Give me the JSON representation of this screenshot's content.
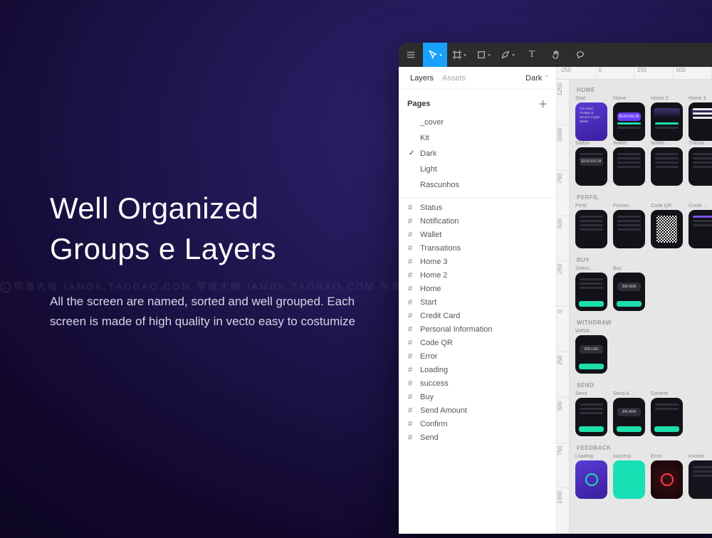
{
  "hero": {
    "title_line1": "Well Organized",
    "title_line2": "Groups e Layers",
    "body": "All the screen are named, sorted and well grouped. Each screen is made of high quality in vecto easy to costumize"
  },
  "watermark": "早道大咖  IAMDK.TAOBAO.COM      早道大咖  IAMDK.TAOBAO.COM      早道大咖  IAMDK.TAOBAO.COM",
  "figma": {
    "toolbar": {
      "items": [
        "menu",
        "move",
        "frame",
        "shape",
        "pen",
        "text",
        "hand",
        "comment"
      ]
    },
    "tabs": {
      "layers": "Layers",
      "assets": "Assets"
    },
    "file_label": "Dark",
    "pages_header": "Pages",
    "pages": [
      {
        "name": "_cover",
        "selected": false
      },
      {
        "name": "Kit",
        "selected": false
      },
      {
        "name": "Dark",
        "selected": true
      },
      {
        "name": "Light",
        "selected": false
      },
      {
        "name": "Rascunhos",
        "selected": false
      }
    ],
    "layers": [
      "Status",
      "Notification",
      "Wallet",
      "Transations",
      "Home 3",
      "Home 2",
      "Home",
      "Start",
      "Credit Card",
      "Personal Information",
      "Code QR",
      "Error",
      "Loading",
      "success",
      "Buy",
      "Send Amount",
      "Confirm",
      "Send"
    ],
    "ruler_h": [
      "-250",
      "0",
      "250",
      "500"
    ],
    "ruler_v": [
      "-1250",
      "-1000",
      "-750",
      "-500",
      "-250",
      "0",
      "250",
      "500",
      "750",
      "1000"
    ],
    "canvas": {
      "sections": [
        {
          "label": "HOME",
          "rows": [
            [
              {
                "name": "Start",
                "style": "purple",
                "text": "The Most Trusted & Secure Crypto Wallet"
              },
              {
                "name": "Home",
                "style": "dark",
                "pill": "$120,910.28",
                "pillStyle": "purple",
                "bars": true
              },
              {
                "name": "Home 2",
                "style": "dark",
                "chart": true,
                "bars": true
              },
              {
                "name": "Home 3",
                "style": "dark",
                "chart": true,
                "listWhite": true
              }
            ],
            [
              {
                "name": "Status",
                "style": "dark",
                "pill": "$120,910.28",
                "pillStyle": "gray",
                "lines": 2
              },
              {
                "name": "Wallet",
                "style": "dark",
                "lines": 4
              },
              {
                "name": "Notific…",
                "style": "dark",
                "lines": 4
              },
              {
                "name": "Transa…",
                "style": "dark",
                "lines": 4
              }
            ]
          ]
        },
        {
          "label": "PERFIL",
          "rows": [
            [
              {
                "name": "Perfil",
                "style": "dark",
                "lines": 4
              },
              {
                "name": "Person…",
                "style": "dark",
                "lines": 4
              },
              {
                "name": "Code QR",
                "style": "dark",
                "qr": true
              },
              {
                "name": "Credit …",
                "style": "dark",
                "lines": 3,
                "lineStyle": "purple"
              }
            ]
          ]
        },
        {
          "label": "BUY",
          "rows": [
            [
              {
                "name": "Select…",
                "style": "dark",
                "lines": 3,
                "bar": true
              },
              {
                "name": "Buy",
                "style": "dark",
                "pill": "200 ADA",
                "pillStyle": "gray",
                "bar": true
              }
            ]
          ]
        },
        {
          "label": "WITHDRAW",
          "rows": [
            [
              {
                "name": "Withdr…",
                "style": "dark",
                "pill": "200 USD",
                "pillStyle": "gray",
                "bar": true
              }
            ]
          ]
        },
        {
          "label": "SEND",
          "rows": [
            [
              {
                "name": "Send",
                "style": "dark",
                "lines": 3,
                "bar": true
              },
              {
                "name": "Send A…",
                "style": "dark",
                "pill": "200 ADA",
                "pillStyle": "gray",
                "bar": true
              },
              {
                "name": "Confirm",
                "style": "dark",
                "lines": 2,
                "bar": true
              }
            ]
          ]
        },
        {
          "label": "FEEDBACK",
          "rows": [
            [
              {
                "name": "Loading",
                "style": "purple",
                "ring": "teal"
              },
              {
                "name": "success",
                "style": "teal",
                "ring": "teal"
              },
              {
                "name": "Error",
                "style": "red",
                "ring": "red"
              },
              {
                "name": "Invoice",
                "style": "blank",
                "lines": 3
              }
            ]
          ]
        }
      ]
    }
  }
}
